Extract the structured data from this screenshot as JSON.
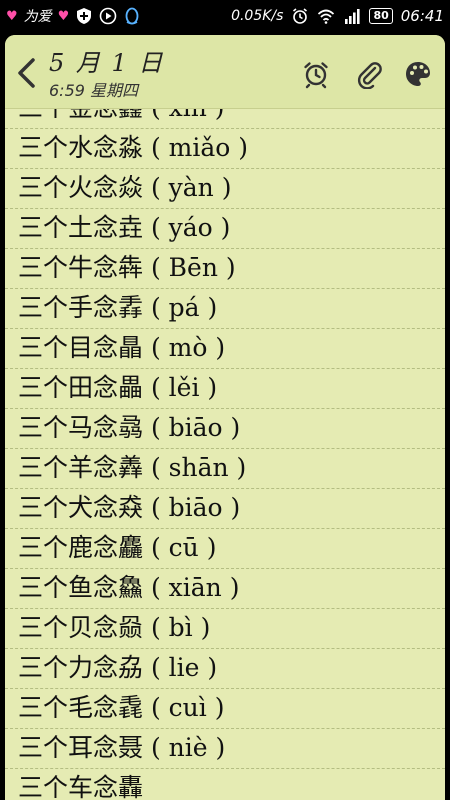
{
  "status_bar": {
    "carrier": "为爱",
    "net_speed": "0.05K/s",
    "battery": "80",
    "time": "06:41"
  },
  "note": {
    "title": "5 月 1 日",
    "subtitle": "6:59 星期四",
    "lines": [
      "三个金念鑫 ( xīn )",
      "三个水念淼 ( miǎo )",
      "三个火念焱 ( yàn )",
      "三个土念垚 ( yáo )",
      "三个牛念犇 ( Bēn )",
      "三个手念掱 ( pá )",
      "三个目念瞐 ( mò )",
      "三个田念畾 ( lěi )",
      "三个马念骉 ( biāo )",
      "三个羊念羴 ( shān )",
      "三个犬念猋 ( biāo )",
      "三个鹿念麤 ( cū )",
      "三个鱼念鱻 ( xiān )",
      "三个贝念赑 ( bì )",
      "三个力念劦 ( lie )",
      "三个毛念毳 ( cuì )",
      "三个耳念聂 ( niè )",
      "三个车念轟"
    ]
  }
}
